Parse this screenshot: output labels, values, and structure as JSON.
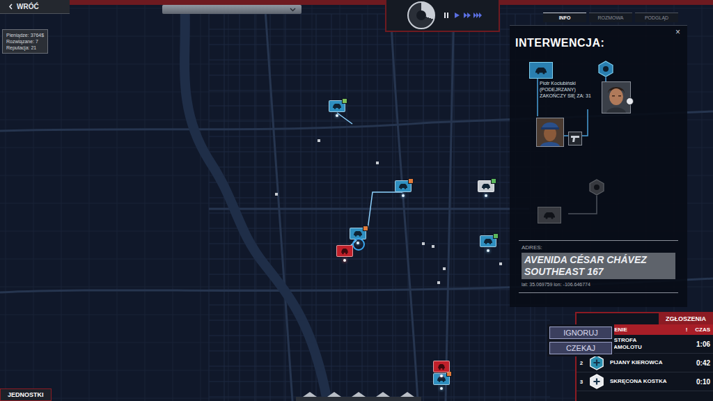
{
  "top_bar": {
    "back_label": "WRÓĆ",
    "dropdown": {
      "open": false
    }
  },
  "clock": {
    "level": 0.3
  },
  "speed_controls": [
    {
      "kind": "pause",
      "selected": true
    },
    {
      "kind": "play",
      "selected": false
    },
    {
      "kind": "fast",
      "selected": false
    },
    {
      "kind": "fastest",
      "selected": false
    }
  ],
  "stats": [
    "Pieniądze: 3764$",
    "Rozwiązane: 7",
    "Reputacja: 21"
  ],
  "panel": {
    "tabs": [
      {
        "label": "INFO",
        "selected": true
      },
      {
        "label": "ROZMOWA",
        "selected": false
      },
      {
        "label": "PODGLĄD",
        "selected": false
      }
    ],
    "close": "×",
    "title": "INTERWENCJA:",
    "nodes": [
      {
        "kind": "vehicle",
        "active": true
      },
      {
        "kind": "badge",
        "active": true
      },
      {
        "kind": "badge",
        "active": false
      },
      {
        "kind": "vehicle",
        "active": false
      }
    ],
    "suspect": {
      "name": "Piotr Kociubiński",
      "role": "(PODEJRZANY)",
      "timer": "ZAKOŃCZY SIĘ ZA: 31"
    },
    "address": {
      "label": "ADRES:",
      "lines": [
        "AVENIDA CÉSAR CHÁVEZ",
        "SOUTHEAST 167"
      ],
      "coords": "lat: 35.069759 lon: -106.646774"
    }
  },
  "map": {
    "units": [
      {
        "color": "#2f8fc0",
        "badge": "#7fbf5a",
        "selected": false
      },
      {
        "color": "#2f8fc0",
        "badge": "#e07a3a",
        "selected": false
      },
      {
        "color": "#2f8fc0",
        "badge": "#e07a3a",
        "selected": true
      },
      {
        "color": "#c8cdd3",
        "badge": "#5cb85c",
        "selected": false
      },
      {
        "color": "#2f8fc0",
        "badge": "#5cb85c",
        "selected": false
      },
      {
        "color": "#2f8fc0",
        "badge": "#e07a3a",
        "selected": false
      }
    ],
    "incidents": [
      {
        "color": "#c0202a"
      },
      {
        "color": "#c0202a"
      }
    ]
  },
  "popup": {
    "buttons": [
      "IGNORUJ",
      "CZEKAJ"
    ]
  },
  "calls": {
    "title": "ZGŁOSZENIA",
    "columns": [
      "SZENIE",
      "!",
      "CZAS"
    ],
    "rows": [
      {
        "number": "",
        "lines": [
          "ASTROFA",
          "SAMOLOTU"
        ],
        "time": "1:06",
        "color": "#2e9e6a"
      },
      {
        "number": "2",
        "lines": [
          "PIJANY KIEROWCA"
        ],
        "time": "0:42",
        "color": "#2a8fb0"
      },
      {
        "number": "3",
        "lines": [
          "SKRĘCONA KOSTKA"
        ],
        "time": "0:10",
        "color": "#e8eaee"
      }
    ]
  },
  "bottom_bar": {
    "units_tab": "JEDNOSTKI"
  }
}
